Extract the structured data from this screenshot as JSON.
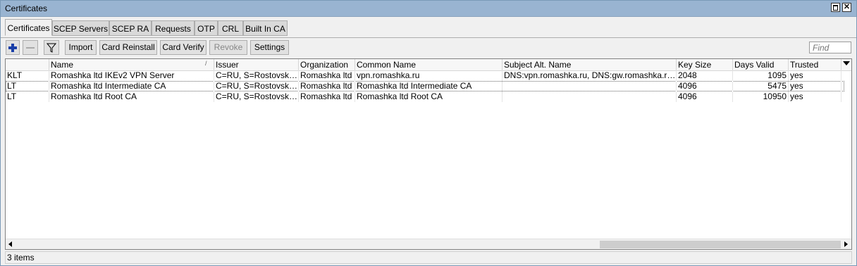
{
  "window": {
    "title": "Certificates"
  },
  "tabs": [
    {
      "label": "Certificates",
      "active": true
    },
    {
      "label": "SCEP Servers"
    },
    {
      "label": "SCEP RA"
    },
    {
      "label": "Requests"
    },
    {
      "label": "OTP"
    },
    {
      "label": "CRL"
    },
    {
      "label": "Built In CA"
    }
  ],
  "toolbar": {
    "import": "Import",
    "card_reinstall": "Card Reinstall",
    "card_verify": "Card Verify",
    "revoke": "Revoke",
    "settings": "Settings",
    "find_placeholder": "Find"
  },
  "table": {
    "columns": [
      "",
      "Name",
      "Issuer",
      "Organization",
      "Common Name",
      "Subject Alt. Name",
      "Key Size",
      "Days Valid",
      "Trusted"
    ],
    "rows": [
      [
        "KLT",
        "Romashka ltd IKEv2 VPN Server",
        "C=RU, S=Rostovskay...",
        "Romashka ltd",
        "vpn.romashka.ru",
        "DNS:vpn.romashka.ru, DNS:gw.romashka.ru, IP:...",
        "2048",
        "1095",
        "yes"
      ],
      [
        "LT",
        "Romashka ltd Intermediate CA",
        "C=RU, S=Rostovskay...",
        "Romashka ltd",
        "Romashka ltd Intermediate CA",
        "",
        "4096",
        "5475",
        "yes"
      ],
      [
        "LT",
        "Romashka ltd Root CA",
        "C=RU, S=Rostovskay...",
        "Romashka ltd",
        "Romashka ltd Root CA",
        "",
        "4096",
        "10950",
        "yes"
      ]
    ]
  },
  "status": {
    "text": "3 items"
  },
  "colors": {
    "titlebar": "#99b4d1",
    "accent_plus": "#1a3fa8"
  }
}
